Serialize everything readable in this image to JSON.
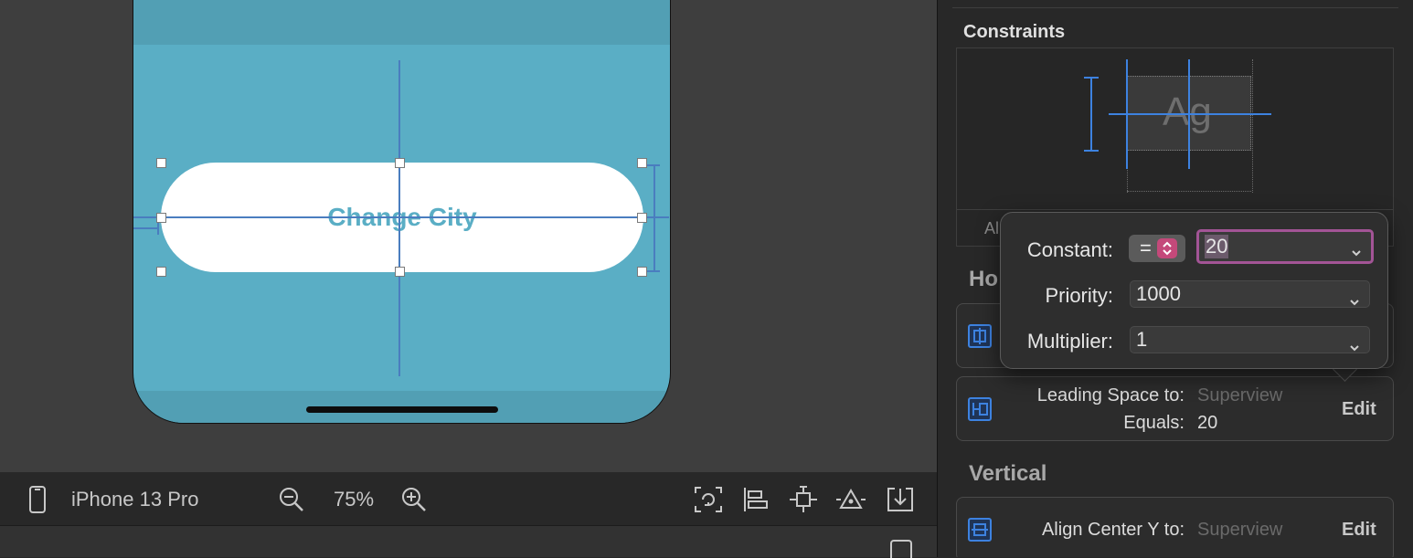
{
  "canvas": {
    "button_label": "Change City"
  },
  "device_bar": {
    "device_name": "iPhone 13 Pro",
    "zoom_level": "75%"
  },
  "inspector": {
    "constraints_title": "Constraints",
    "preview_glyph": "Ag",
    "align_label_partial": "Al",
    "horizontal_title_partial": "Ho",
    "vertical_title": "Vertical",
    "rows": [
      {
        "label": "Leading Space to:",
        "target": "Superview",
        "equals_label": "Equals:",
        "equals_value": "20",
        "edit_label": "Edit"
      },
      {
        "label": "Align Center Y to:",
        "target": "Superview",
        "edit_label": "Edit"
      }
    ]
  },
  "popover": {
    "constant_label": "Constant:",
    "relation": "=",
    "constant_value": "20",
    "priority_label": "Priority:",
    "priority_value": "1000",
    "multiplier_label": "Multiplier:",
    "multiplier_value": "1"
  },
  "colors": {
    "view_background": "#5aaec5",
    "button_text": "#5aaec5",
    "constraint_guide": "#4a7dbf",
    "constant_focus": "#a35496",
    "icon_blue": "#3d82e0"
  }
}
